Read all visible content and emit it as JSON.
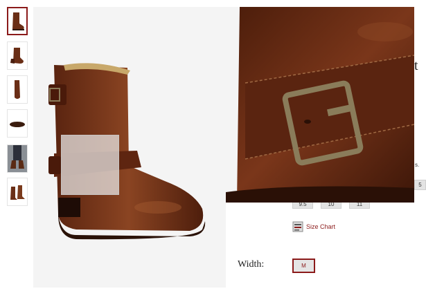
{
  "thumbnails": [
    {
      "view": "side-view",
      "selected": true
    },
    {
      "view": "angled-view",
      "selected": false
    },
    {
      "view": "front-view",
      "selected": false
    },
    {
      "view": "sole-view",
      "selected": false
    },
    {
      "view": "worn-view",
      "selected": false
    },
    {
      "view": "pair-view",
      "selected": false
    }
  ],
  "product": {
    "title_fragment": "t",
    "sizes_visible": [
      "9.5",
      "10",
      "11"
    ],
    "size_edge_fragment": "5",
    "size_note_fragment": "s.",
    "size_chart_label": "Size Chart",
    "width_label": "Width:",
    "width_options": [
      "M"
    ]
  },
  "colors": {
    "accent": "#8b1a1a",
    "leather": "#6a2e16",
    "background": "#f4f4f4"
  }
}
